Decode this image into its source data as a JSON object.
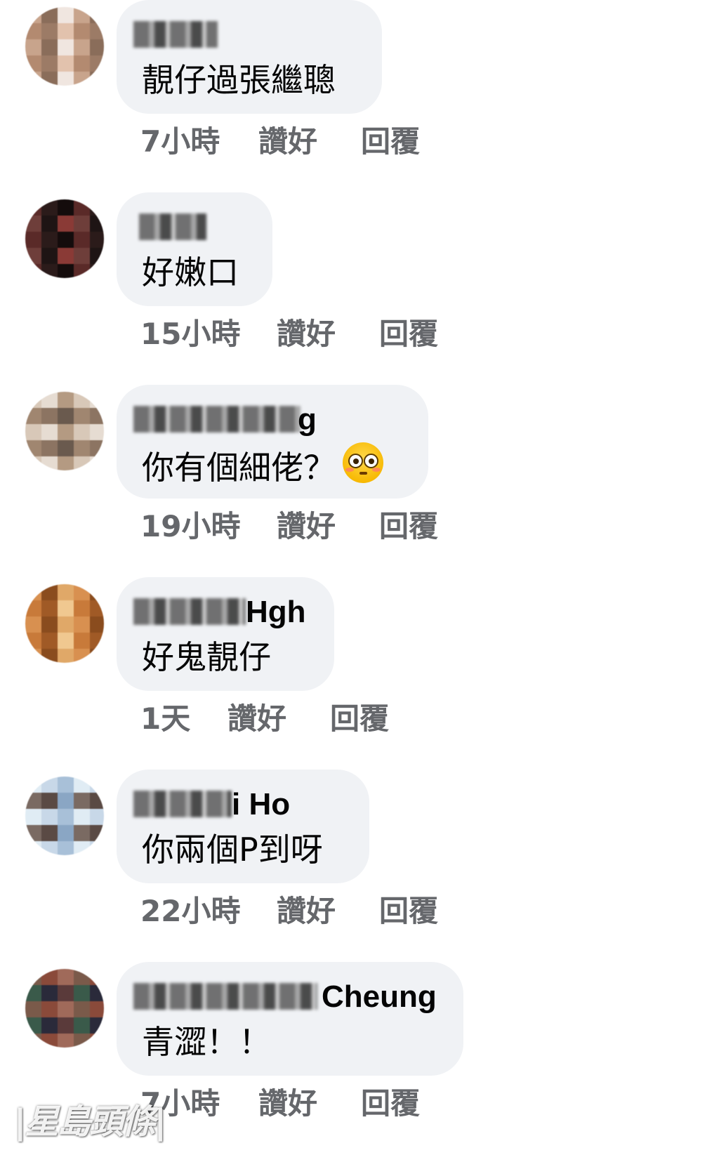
{
  "comments": [
    {
      "author_visible": "",
      "text": "靚仔過張繼聰",
      "time": "7小時",
      "like_label": "讚好",
      "reply_label": "回覆",
      "avatar_colors": [
        "#c8a48c",
        "#e2c2ad",
        "#8a6d5a",
        "#b38a70",
        "#f0e6e0",
        "#9c7b66"
      ]
    },
    {
      "author_visible": "",
      "text": "好嫩口",
      "time": "15小時",
      "like_label": "讚好",
      "reply_label": "回覆",
      "avatar_colors": [
        "#1e1414",
        "#5a2a28",
        "#8a3a36",
        "#2b1b1a",
        "#6e3e3a",
        "#140c0c"
      ]
    },
    {
      "author_visible": "g",
      "text": "你有個細佬？",
      "emoji": "flushed-face",
      "time": "19小時",
      "like_label": "讚好",
      "reply_label": "回覆",
      "avatar_colors": [
        "#b49a82",
        "#8c7462",
        "#d8c8b8",
        "#6a5a4e",
        "#e6dcd2",
        "#a08670"
      ]
    },
    {
      "author_visible": "Hgh",
      "text": "好鬼靚仔",
      "time": "1天",
      "like_label": "讚好",
      "reply_label": "回覆",
      "avatar_colors": [
        "#c87a3a",
        "#e0a868",
        "#a05a26",
        "#d89050",
        "#f0c890",
        "#8a4c1e"
      ]
    },
    {
      "author_visible": "i Ho",
      "text": "你兩個P到呀",
      "time": "22小時",
      "like_label": "讚好",
      "reply_label": "回覆",
      "avatar_colors": [
        "#c8d8e8",
        "#7a6a62",
        "#a8c0d8",
        "#5a4a44",
        "#e0ecf4",
        "#8aa6c4"
      ]
    },
    {
      "author_visible": "Cheung",
      "text": "青澀！！",
      "time": "7小時",
      "like_label": "讚好",
      "reply_label": "回覆",
      "avatar_colors": [
        "#5a3a3a",
        "#8a4a3a",
        "#3a5a4a",
        "#a06a5a",
        "#2a2a3a",
        "#7a5a4a"
      ]
    }
  ],
  "watermark": "|星島頭條|"
}
